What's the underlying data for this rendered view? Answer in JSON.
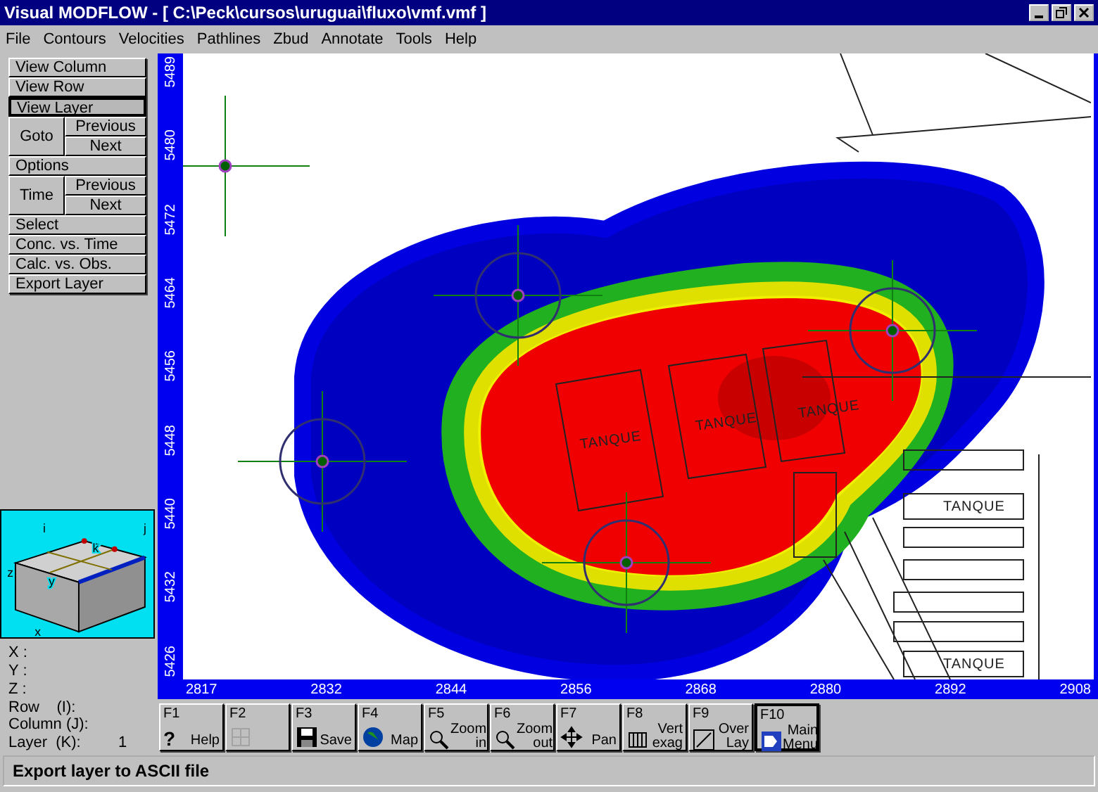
{
  "window": {
    "title": "Visual MODFLOW - [ C:\\Peck\\cursos\\uruguai\\fluxo\\vmf.vmf ]"
  },
  "menu": [
    "File",
    "Contours",
    "Velocities",
    "Pathlines",
    "Zbud",
    "Annotate",
    "Tools",
    "Help"
  ],
  "side_buttons": [
    {
      "kind": "single",
      "label": "View Column",
      "selected": false
    },
    {
      "kind": "single",
      "label": "View Row",
      "selected": false
    },
    {
      "kind": "single",
      "label": "View Layer",
      "selected": true
    },
    {
      "kind": "group",
      "label": "Goto",
      "options": [
        "Previous",
        "Next"
      ]
    },
    {
      "kind": "single",
      "label": "Options",
      "selected": false
    },
    {
      "kind": "group",
      "label": "Time",
      "options": [
        "Previous",
        "Next"
      ]
    },
    {
      "kind": "single",
      "label": "Select",
      "selected": false
    },
    {
      "kind": "single",
      "label": "Conc. vs. Time",
      "selected": false
    },
    {
      "kind": "single",
      "label": "Calc. vs. Obs.",
      "selected": false
    },
    {
      "kind": "single",
      "label": "Export Layer",
      "selected": false
    }
  ],
  "cube_labels": [
    "i",
    "j",
    "k",
    "z",
    "y",
    "x"
  ],
  "coordinates": [
    {
      "label": "X :"
    },
    {
      "label": "Y :"
    },
    {
      "label": "Z :"
    },
    {
      "label": "Row    (I):"
    },
    {
      "label": "Column (J):"
    },
    {
      "label": "Layer  (K):",
      "value": "1"
    }
  ],
  "map": {
    "y_ticks": [
      "5489",
      "5480",
      "5472",
      "5464",
      "5456",
      "5448",
      "5440",
      "5432",
      "5426"
    ],
    "x_ticks": [
      "2817",
      "2832",
      "2844",
      "2856",
      "2868",
      "2880",
      "2892",
      "2908"
    ],
    "tank_labels": [
      "TANQUE",
      "TANQUE",
      "TANQUE",
      "TANQUE",
      "TANQUE"
    ]
  },
  "function_keys": [
    {
      "key": "F1",
      "glyph": "?",
      "label": "Help",
      "disabled": false,
      "selected": false
    },
    {
      "key": "F2",
      "disabled": true,
      "selected": false
    },
    {
      "key": "F3",
      "label": "Save",
      "disabled": false,
      "selected": false
    },
    {
      "key": "F4",
      "label": "Map",
      "disabled": false,
      "selected": false
    },
    {
      "key": "F5",
      "label": "Zoom in",
      "disabled": false,
      "selected": false
    },
    {
      "key": "F6",
      "label": "Zoom out",
      "disabled": false,
      "selected": false
    },
    {
      "key": "F7",
      "label": "Pan",
      "disabled": false,
      "selected": false
    },
    {
      "key": "F8",
      "label": "Vert exag",
      "disabled": false,
      "selected": false
    },
    {
      "key": "F9",
      "label": "Over Lay",
      "disabled": false,
      "selected": false
    },
    {
      "key": "F10",
      "label": "Main Menu",
      "disabled": false,
      "selected": true
    }
  ],
  "status_bar": "Export layer to ASCII file"
}
